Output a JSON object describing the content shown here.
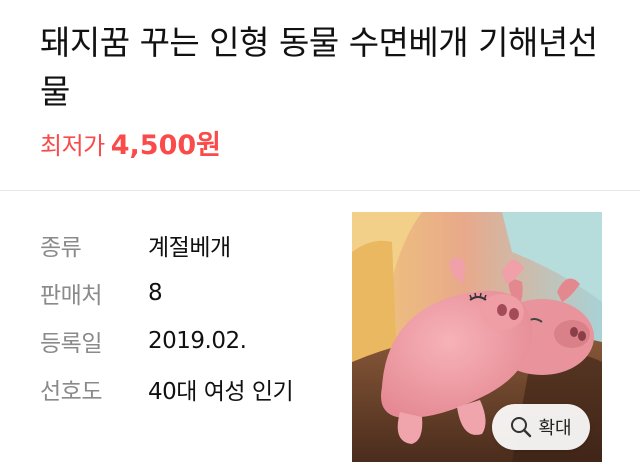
{
  "product": {
    "title": "돼지꿈 꾸는 인형 동물 수면베개 기해년선물",
    "price_label": "최저가",
    "price_value": "4,500원"
  },
  "specs": [
    {
      "key": "종류",
      "value": "계절베개"
    },
    {
      "key": "판매처",
      "value": "8"
    },
    {
      "key": "등록일",
      "value": "2019.02."
    },
    {
      "key": "선호도",
      "value": "40대 여성 인기"
    }
  ],
  "image": {
    "zoom_label": "확대",
    "zoom_icon": "magnifier-icon"
  },
  "colors": {
    "price": "#fa4a4a",
    "spec_key": "#8a8a8a"
  }
}
